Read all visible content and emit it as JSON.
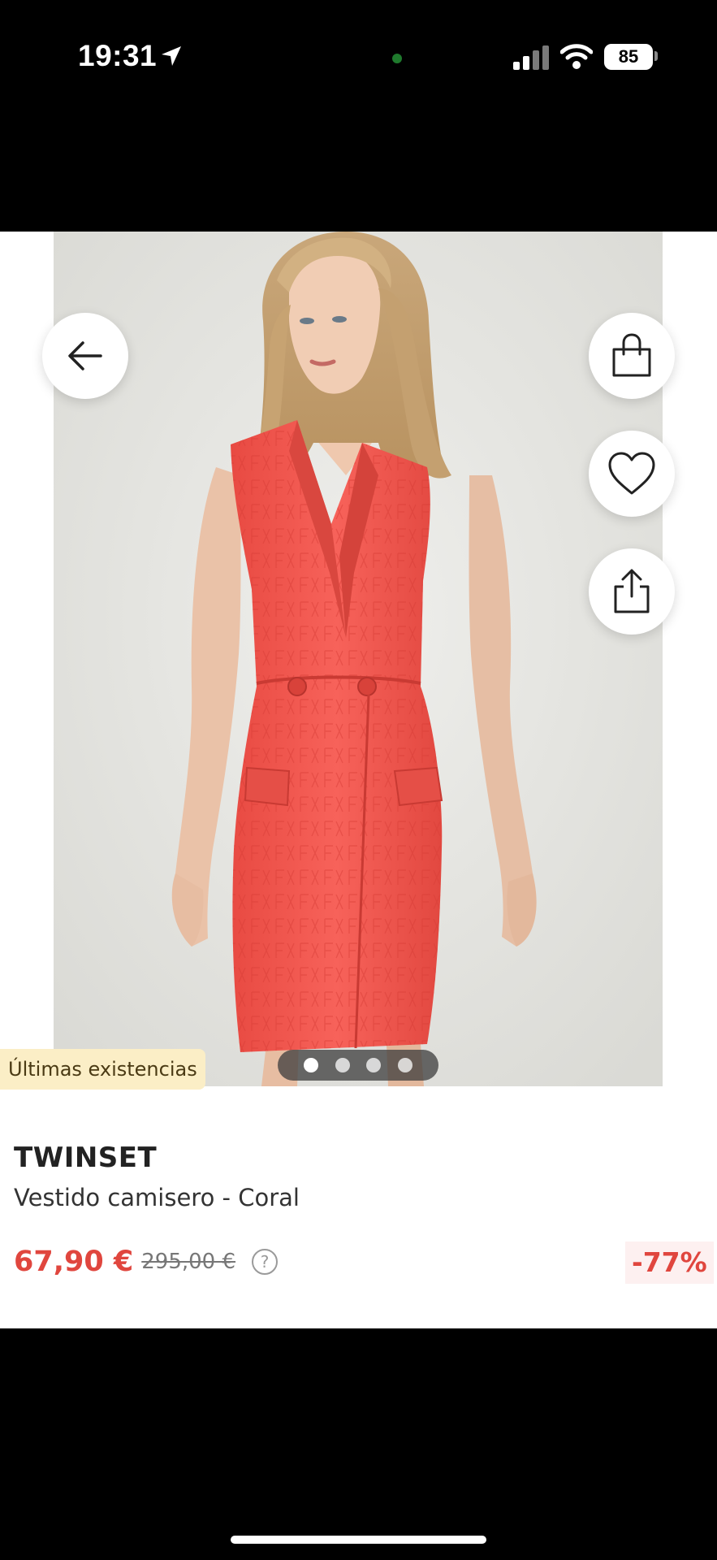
{
  "status_bar": {
    "time": "19:31",
    "battery": "85"
  },
  "product": {
    "stock_badge": "Últimas existencias",
    "brand": "TWINSET",
    "name": "Vestido camisero - Coral",
    "price": "67,90 €",
    "original_price": "295,00 €",
    "discount": "-77%",
    "help_symbol": "?",
    "gallery_image_count": 4,
    "gallery_active_index": 0
  },
  "icons": {
    "back": "arrow-left-icon",
    "bag": "shopping-bag-icon",
    "favorite": "heart-icon",
    "share": "share-icon"
  },
  "colors": {
    "price": "#e0463e",
    "dress": "#f2584e",
    "badge_bg": "#fbeec6"
  }
}
